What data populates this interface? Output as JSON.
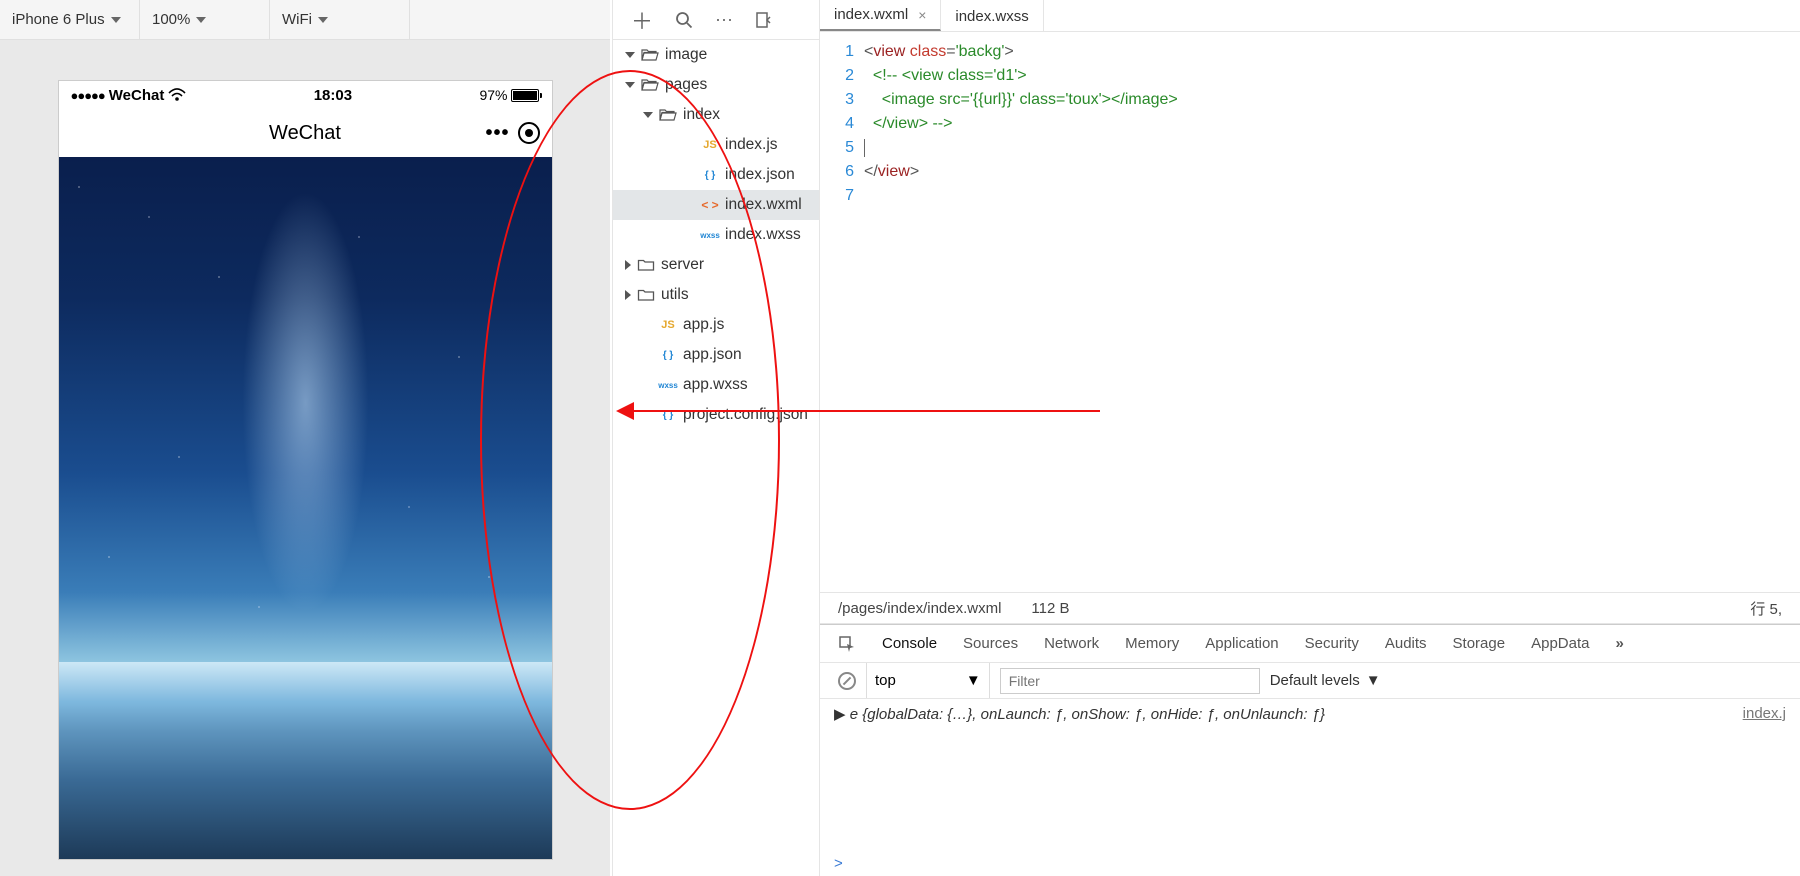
{
  "toolbar": {
    "device": "iPhone 6 Plus",
    "zoom": "100%",
    "network": "WiFi"
  },
  "simulator": {
    "carrier": "WeChat",
    "time": "18:03",
    "battery_pct": "97%",
    "nav_title": "WeChat"
  },
  "explorer_toolbar": {
    "add": "+",
    "search": "search",
    "more": "···",
    "collapse": "collapse"
  },
  "explorer": {
    "items": [
      {
        "label": "image",
        "icon": "folder-open",
        "indent": 1,
        "expand": "down"
      },
      {
        "label": "pages",
        "icon": "folder-open",
        "indent": 1,
        "expand": "down"
      },
      {
        "label": "index",
        "icon": "folder-open",
        "indent": 2,
        "expand": "down"
      },
      {
        "label": "index.js",
        "icon": "js",
        "indent": 4,
        "expand": "blank"
      },
      {
        "label": "index.json",
        "icon": "json",
        "indent": 4,
        "expand": "blank"
      },
      {
        "label": "index.wxml",
        "icon": "wxml",
        "indent": 4,
        "expand": "blank",
        "selected": true
      },
      {
        "label": "index.wxss",
        "icon": "wxss",
        "indent": 4,
        "expand": "blank"
      },
      {
        "label": "server",
        "icon": "folder",
        "indent": 1,
        "expand": "right"
      },
      {
        "label": "utils",
        "icon": "folder",
        "indent": 1,
        "expand": "right"
      },
      {
        "label": "app.js",
        "icon": "js",
        "indent": 2,
        "expand": "blank"
      },
      {
        "label": "app.json",
        "icon": "json",
        "indent": 2,
        "expand": "blank"
      },
      {
        "label": "app.wxss",
        "icon": "wxss",
        "indent": 2,
        "expand": "blank"
      },
      {
        "label": "project.config.json",
        "icon": "json",
        "indent": 2,
        "expand": "blank"
      }
    ]
  },
  "editor": {
    "tabs": [
      {
        "label": "index.wxml",
        "active": true,
        "close": "×"
      },
      {
        "label": "index.wxss",
        "active": false,
        "close": ""
      }
    ],
    "gutter": [
      "1",
      "2",
      "3",
      "4",
      "5",
      "6",
      "7"
    ],
    "code": {
      "l1_a": "<",
      "l1_b": "view ",
      "l1_c": "class",
      "l1_d": "=",
      "l1_e": "'backg'",
      "l1_f": ">",
      "l2": "  <!-- <view class='d1'>",
      "l3": "    <image src='{{url}}' class='toux'></image>",
      "l4": "  </view> -->",
      "l5": "",
      "l6_a": "</",
      "l6_b": "view",
      "l6_c": ">",
      "l7": ""
    },
    "status": {
      "path": "/pages/index/index.wxml",
      "size": "112 B",
      "pos": "行 5,"
    }
  },
  "devtools": {
    "tabs": [
      "Console",
      "Sources",
      "Network",
      "Memory",
      "Application",
      "Security",
      "Audits",
      "Storage",
      "AppData"
    ],
    "more": "»",
    "filter": {
      "context": "top",
      "placeholder": "Filter",
      "levels": "Default levels"
    },
    "console_line": "e {globalData: {…}, onLaunch: ƒ, onShow: ƒ, onHide: ƒ, onUnlaunch: ƒ}",
    "console_src": "index.j",
    "prompt": ">"
  },
  "icons": {
    "js": "JS",
    "json": "{ }",
    "wxml": "< >",
    "wxss": "wxss"
  }
}
